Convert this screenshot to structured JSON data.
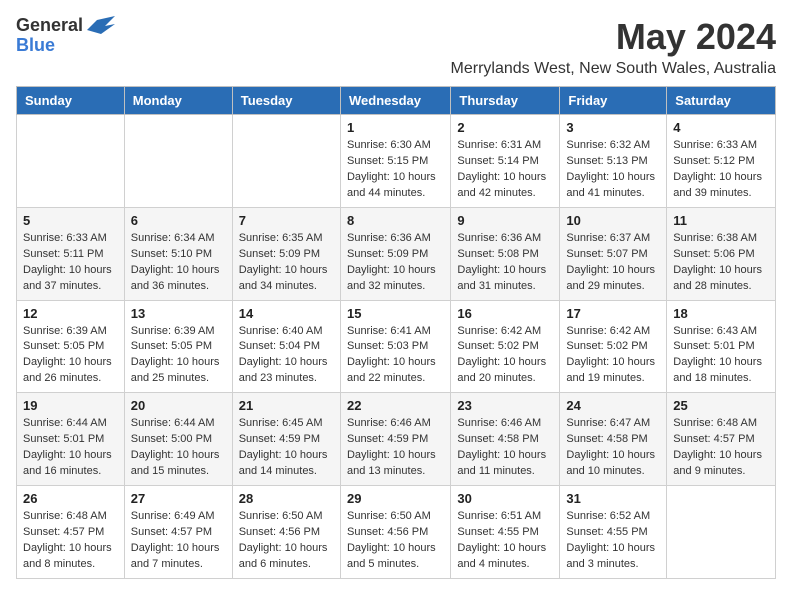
{
  "logo": {
    "general": "General",
    "blue": "Blue"
  },
  "title": "May 2024",
  "location": "Merrylands West, New South Wales, Australia",
  "days_of_week": [
    "Sunday",
    "Monday",
    "Tuesday",
    "Wednesday",
    "Thursday",
    "Friday",
    "Saturday"
  ],
  "weeks": [
    [
      {
        "day": "",
        "info": ""
      },
      {
        "day": "",
        "info": ""
      },
      {
        "day": "",
        "info": ""
      },
      {
        "day": "1",
        "info": "Sunrise: 6:30 AM\nSunset: 5:15 PM\nDaylight: 10 hours\nand 44 minutes."
      },
      {
        "day": "2",
        "info": "Sunrise: 6:31 AM\nSunset: 5:14 PM\nDaylight: 10 hours\nand 42 minutes."
      },
      {
        "day": "3",
        "info": "Sunrise: 6:32 AM\nSunset: 5:13 PM\nDaylight: 10 hours\nand 41 minutes."
      },
      {
        "day": "4",
        "info": "Sunrise: 6:33 AM\nSunset: 5:12 PM\nDaylight: 10 hours\nand 39 minutes."
      }
    ],
    [
      {
        "day": "5",
        "info": "Sunrise: 6:33 AM\nSunset: 5:11 PM\nDaylight: 10 hours\nand 37 minutes."
      },
      {
        "day": "6",
        "info": "Sunrise: 6:34 AM\nSunset: 5:10 PM\nDaylight: 10 hours\nand 36 minutes."
      },
      {
        "day": "7",
        "info": "Sunrise: 6:35 AM\nSunset: 5:09 PM\nDaylight: 10 hours\nand 34 minutes."
      },
      {
        "day": "8",
        "info": "Sunrise: 6:36 AM\nSunset: 5:09 PM\nDaylight: 10 hours\nand 32 minutes."
      },
      {
        "day": "9",
        "info": "Sunrise: 6:36 AM\nSunset: 5:08 PM\nDaylight: 10 hours\nand 31 minutes."
      },
      {
        "day": "10",
        "info": "Sunrise: 6:37 AM\nSunset: 5:07 PM\nDaylight: 10 hours\nand 29 minutes."
      },
      {
        "day": "11",
        "info": "Sunrise: 6:38 AM\nSunset: 5:06 PM\nDaylight: 10 hours\nand 28 minutes."
      }
    ],
    [
      {
        "day": "12",
        "info": "Sunrise: 6:39 AM\nSunset: 5:05 PM\nDaylight: 10 hours\nand 26 minutes."
      },
      {
        "day": "13",
        "info": "Sunrise: 6:39 AM\nSunset: 5:05 PM\nDaylight: 10 hours\nand 25 minutes."
      },
      {
        "day": "14",
        "info": "Sunrise: 6:40 AM\nSunset: 5:04 PM\nDaylight: 10 hours\nand 23 minutes."
      },
      {
        "day": "15",
        "info": "Sunrise: 6:41 AM\nSunset: 5:03 PM\nDaylight: 10 hours\nand 22 minutes."
      },
      {
        "day": "16",
        "info": "Sunrise: 6:42 AM\nSunset: 5:02 PM\nDaylight: 10 hours\nand 20 minutes."
      },
      {
        "day": "17",
        "info": "Sunrise: 6:42 AM\nSunset: 5:02 PM\nDaylight: 10 hours\nand 19 minutes."
      },
      {
        "day": "18",
        "info": "Sunrise: 6:43 AM\nSunset: 5:01 PM\nDaylight: 10 hours\nand 18 minutes."
      }
    ],
    [
      {
        "day": "19",
        "info": "Sunrise: 6:44 AM\nSunset: 5:01 PM\nDaylight: 10 hours\nand 16 minutes."
      },
      {
        "day": "20",
        "info": "Sunrise: 6:44 AM\nSunset: 5:00 PM\nDaylight: 10 hours\nand 15 minutes."
      },
      {
        "day": "21",
        "info": "Sunrise: 6:45 AM\nSunset: 4:59 PM\nDaylight: 10 hours\nand 14 minutes."
      },
      {
        "day": "22",
        "info": "Sunrise: 6:46 AM\nSunset: 4:59 PM\nDaylight: 10 hours\nand 13 minutes."
      },
      {
        "day": "23",
        "info": "Sunrise: 6:46 AM\nSunset: 4:58 PM\nDaylight: 10 hours\nand 11 minutes."
      },
      {
        "day": "24",
        "info": "Sunrise: 6:47 AM\nSunset: 4:58 PM\nDaylight: 10 hours\nand 10 minutes."
      },
      {
        "day": "25",
        "info": "Sunrise: 6:48 AM\nSunset: 4:57 PM\nDaylight: 10 hours\nand 9 minutes."
      }
    ],
    [
      {
        "day": "26",
        "info": "Sunrise: 6:48 AM\nSunset: 4:57 PM\nDaylight: 10 hours\nand 8 minutes."
      },
      {
        "day": "27",
        "info": "Sunrise: 6:49 AM\nSunset: 4:57 PM\nDaylight: 10 hours\nand 7 minutes."
      },
      {
        "day": "28",
        "info": "Sunrise: 6:50 AM\nSunset: 4:56 PM\nDaylight: 10 hours\nand 6 minutes."
      },
      {
        "day": "29",
        "info": "Sunrise: 6:50 AM\nSunset: 4:56 PM\nDaylight: 10 hours\nand 5 minutes."
      },
      {
        "day": "30",
        "info": "Sunrise: 6:51 AM\nSunset: 4:55 PM\nDaylight: 10 hours\nand 4 minutes."
      },
      {
        "day": "31",
        "info": "Sunrise: 6:52 AM\nSunset: 4:55 PM\nDaylight: 10 hours\nand 3 minutes."
      },
      {
        "day": "",
        "info": ""
      }
    ]
  ]
}
